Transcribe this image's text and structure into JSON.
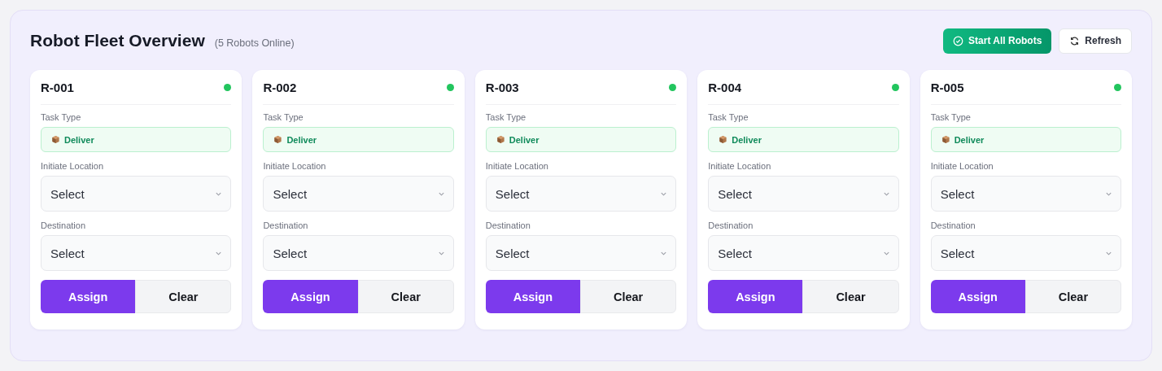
{
  "header": {
    "title": "Robot Fleet Overview",
    "subtitle": "(5 Robots Online)",
    "buttons": [
      {
        "kind": "primary",
        "label": "Start All Robots"
      },
      {
        "kind": "secondary",
        "label": "Refresh"
      }
    ]
  },
  "robots": [
    {
      "id": "R-001",
      "online": true,
      "task_label": "Task Type",
      "task": "Deliver",
      "fields": [
        {
          "label": "Initiate Location",
          "value": "Select"
        },
        {
          "label": "Destination",
          "value": "Select"
        }
      ],
      "actions": [
        "Assign",
        "Clear"
      ]
    },
    {
      "id": "R-002",
      "online": true,
      "task_label": "Task Type",
      "task": "Deliver",
      "fields": [
        {
          "label": "Initiate Location",
          "value": "Select"
        },
        {
          "label": "Destination",
          "value": "Select"
        }
      ],
      "actions": [
        "Assign",
        "Clear"
      ]
    },
    {
      "id": "R-003",
      "online": true,
      "task_label": "Task Type",
      "task": "Deliver",
      "fields": [
        {
          "label": "Initiate Location",
          "value": "Select"
        },
        {
          "label": "Destination",
          "value": "Select"
        }
      ],
      "actions": [
        "Assign",
        "Clear"
      ]
    },
    {
      "id": "R-004",
      "online": true,
      "task_label": "Task Type",
      "task": "Deliver",
      "fields": [
        {
          "label": "Initiate Location",
          "value": "Select"
        },
        {
          "label": "Destination",
          "value": "Select"
        }
      ],
      "actions": [
        "Assign",
        "Clear"
      ]
    },
    {
      "id": "R-005",
      "online": true,
      "task_label": "Task Type",
      "task": "Deliver",
      "fields": [
        {
          "label": "Initiate Location",
          "value": "Select"
        },
        {
          "label": "Destination",
          "value": "Select"
        }
      ],
      "actions": [
        "Assign",
        "Clear"
      ]
    }
  ]
}
